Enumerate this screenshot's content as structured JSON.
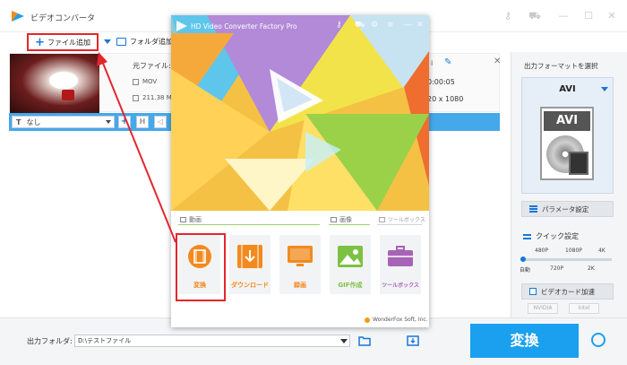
{
  "app": {
    "title": "ビデオコンバータ",
    "colors": {
      "accent": "#1aa0ee",
      "highlight": "#e3262c"
    }
  },
  "toolbar": {
    "add_file_label": "ファイル追加",
    "add_folder_label": "フォルダ追加"
  },
  "file": {
    "source_label": "元ファイル: D",
    "format": "MOV",
    "size": "211.38 MB",
    "duration_frag": "0:00:05",
    "resolution_frag": "20 x 1080",
    "icon_frag": "i"
  },
  "subtitle": {
    "value": "なし"
  },
  "popup": {
    "title": "HD Video Converter Factory Pro",
    "sections": {
      "video": "動画",
      "image": "画像",
      "toolbox": "ツールボックス"
    },
    "tiles": [
      {
        "label": "変換",
        "icon": "film-icon",
        "color": "#f28a1e"
      },
      {
        "label": "ダウンロード",
        "icon": "download-icon",
        "color": "#f28a1e"
      },
      {
        "label": "録画",
        "icon": "screen-record-icon",
        "color": "#f28a1e"
      },
      {
        "label": "GIF作成",
        "icon": "image-icon",
        "color": "#7dc142"
      },
      {
        "label": "ツールボックス",
        "icon": "toolbox-icon",
        "color": "#a862b7"
      }
    ],
    "footer": "WonderFox Soft, Inc."
  },
  "right_panel": {
    "title": "出力フォーマットを選択",
    "format": "AVI",
    "format_image_text": "AVI",
    "param_label": "パラメータ設定",
    "quick_label": "クイック設定",
    "quick_ticks_top": [
      "480P",
      "1080P",
      "4K"
    ],
    "quick_ticks_bottom": [
      "自動",
      "720P",
      "2K"
    ],
    "gpu_label": "ビデオカード加速",
    "vendors": [
      "NVIDIA",
      "Intel"
    ]
  },
  "bottom": {
    "output_label": "出力フォルダ:",
    "output_path": "D:\\テストファイル",
    "convert_label": "変換"
  }
}
